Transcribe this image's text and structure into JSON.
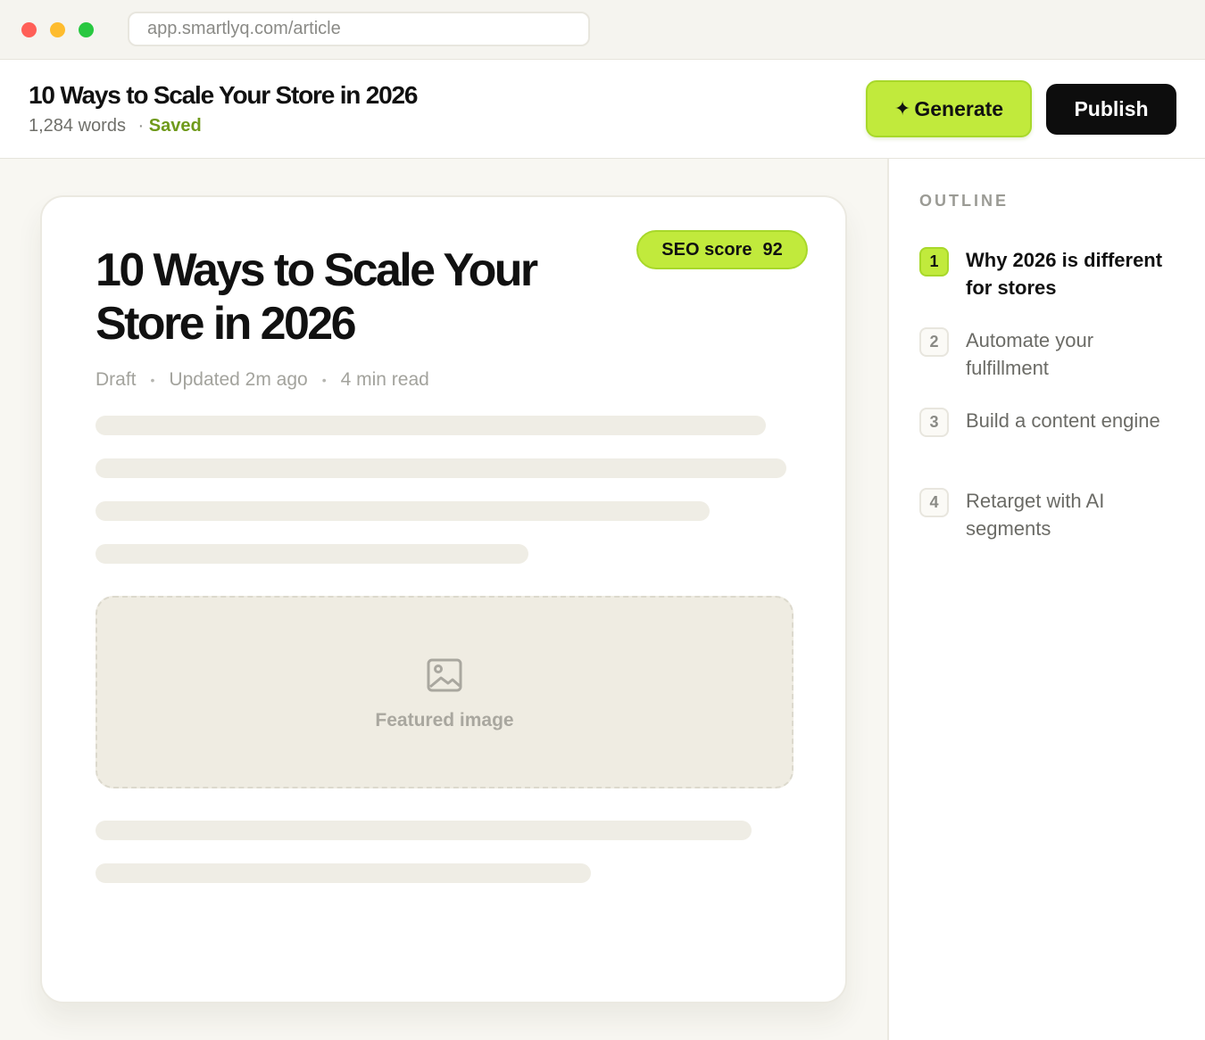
{
  "browser": {
    "url": "app.smartlyq.com/article"
  },
  "header": {
    "title": "10 Ways to Scale Your Store in 2026",
    "word_count": "1,284 words",
    "separator": "·",
    "status": "Saved",
    "generate_icon": "✦",
    "generate_label": "Generate",
    "publish_label": "Publish"
  },
  "article": {
    "seo_label": "SEO score",
    "seo_value": "92",
    "title": "10 Ways to Scale Your Store in 2026",
    "status": "Draft",
    "updated": "Updated 2m ago",
    "read_time": "4 min read",
    "meta_separator": "•",
    "featured_image_label": "Featured image",
    "featured_image_icon": "image-icon"
  },
  "outline": {
    "heading": "OUTLINE",
    "items": [
      {
        "num": "1",
        "label": "Why 2026 is different for stores",
        "active": true
      },
      {
        "num": "2",
        "label": "Automate your fulfillment",
        "active": false
      },
      {
        "num": "3",
        "label": "Build a content engine",
        "active": false
      },
      {
        "num": "4",
        "label": "Retarget with AI segments",
        "active": false
      }
    ]
  },
  "colors": {
    "accent": "#c1ea3c",
    "saved_green": "#6f9a1b",
    "publish_bg": "#0d0d0d"
  }
}
